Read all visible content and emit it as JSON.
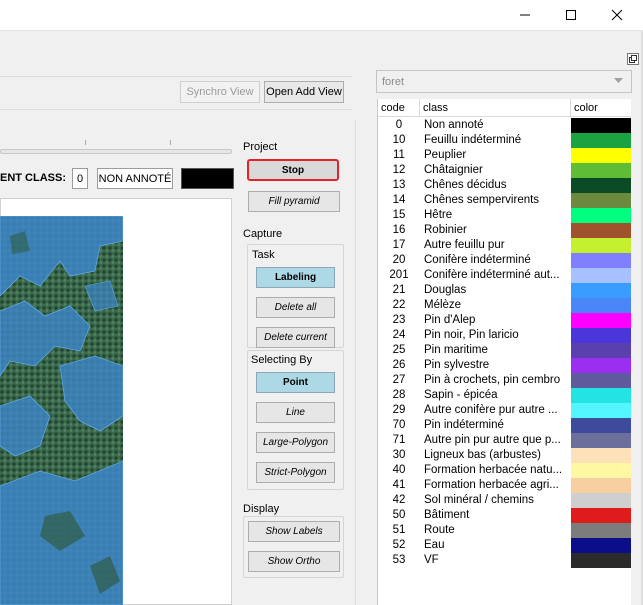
{
  "window": {
    "minimize_icon": "minimize-icon",
    "maximize_icon": "maximize-icon",
    "close_icon": "close-icon"
  },
  "toolbar": {
    "synchro_view_label": "Synchro View",
    "open_add_view_label": "Open Add View"
  },
  "current_class": {
    "label": "ENT CLASS:",
    "count": "0",
    "name": "NON ANNOTÉ",
    "color": "#000000"
  },
  "project": {
    "title": "Project",
    "stop_label": "Stop",
    "fill_pyramid_label": "Fill pyramid"
  },
  "capture": {
    "title": "Capture",
    "task_title": "Task",
    "labeling_label": "Labeling",
    "delete_all_label": "Delete all",
    "delete_current_label": "Delete current",
    "selecting_by_title": "Selecting By",
    "point_label": "Point",
    "line_label": "Line",
    "large_polygon_label": "Large-Polygon",
    "strict_polygon_label": "Strict-Polygon"
  },
  "display": {
    "title": "Display",
    "show_labels_label": "Show Labels",
    "show_ortho_label": "Show Ortho"
  },
  "dock": {
    "combo_value": "foret",
    "columns": {
      "code": "code",
      "class": "class",
      "color": "color"
    },
    "rows": [
      {
        "code": "0",
        "class": "Non annoté",
        "color": "#000000"
      },
      {
        "code": "10",
        "class": "Feuillu indéterminé",
        "color": "#1ba341"
      },
      {
        "code": "11",
        "class": "Peuplier",
        "color": "#ffff00"
      },
      {
        "code": "12",
        "class": "Châtaignier",
        "color": "#5fbd35"
      },
      {
        "code": "13",
        "class": "Chênes décidus",
        "color": "#0a4b25"
      },
      {
        "code": "14",
        "class": "Chênes sempervirents",
        "color": "#6b8a3e"
      },
      {
        "code": "15",
        "class": "Hêtre",
        "color": "#00ff7f"
      },
      {
        "code": "16",
        "class": "Robinier",
        "color": "#a0522d"
      },
      {
        "code": "17",
        "class": "Autre feuillu pur",
        "color": "#c4f02f"
      },
      {
        "code": "20",
        "class": "Conifère indéterminé",
        "color": "#8080ff"
      },
      {
        "code": "201",
        "class": "Conifère indéterminé aut...",
        "color": "#a7c0ff"
      },
      {
        "code": "21",
        "class": "Douglas",
        "color": "#3a9cff"
      },
      {
        "code": "22",
        "class": "Mélèze",
        "color": "#4a86f7"
      },
      {
        "code": "23",
        "class": "Pin d'Alep",
        "color": "#ff00ff"
      },
      {
        "code": "24",
        "class": "Pin noir, Pin laricio",
        "color": "#4b36d9"
      },
      {
        "code": "25",
        "class": "Pin maritime",
        "color": "#5a3fae"
      },
      {
        "code": "26",
        "class": "Pin sylvestre",
        "color": "#9b2ff1"
      },
      {
        "code": "27",
        "class": "Pin à crochets, pin cembro",
        "color": "#5f5a9c"
      },
      {
        "code": "28",
        "class": "Sapin - épicéa",
        "color": "#24e3e3"
      },
      {
        "code": "29",
        "class": "Autre conifère pur autre ...",
        "color": "#53f5ff"
      },
      {
        "code": "70",
        "class": "Pin indéterminé",
        "color": "#3e4b9a"
      },
      {
        "code": "71",
        "class": "Autre pin pur autre que p...",
        "color": "#6b6f9a"
      },
      {
        "code": "30",
        "class": "Ligneux bas (arbustes)",
        "color": "#fde1b8"
      },
      {
        "code": "40",
        "class": "Formation herbacée natu...",
        "color": "#fff7a1"
      },
      {
        "code": "41",
        "class": "Formation herbacée agri...",
        "color": "#f7cfa0"
      },
      {
        "code": "42",
        "class": "Sol minéral / chemins",
        "color": "#cfcfcf"
      },
      {
        "code": "50",
        "class": "Bâtiment",
        "color": "#e01b1b"
      },
      {
        "code": "51",
        "class": "Route",
        "color": "#7c7c7c"
      },
      {
        "code": "52",
        "class": "Eau",
        "color": "#0b0d8a"
      },
      {
        "code": "53",
        "class": "VF",
        "color": "#2b2b2b"
      }
    ]
  }
}
